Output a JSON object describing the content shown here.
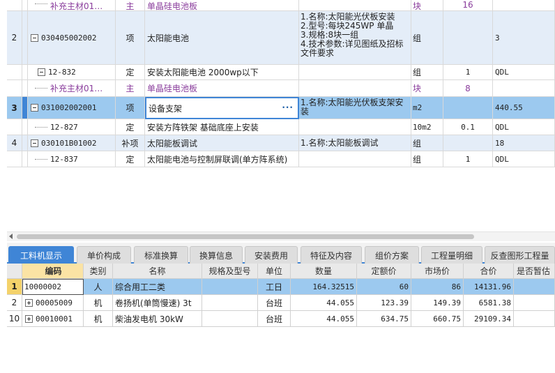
{
  "upper_grid": {
    "rows": [
      {
        "num": "",
        "code": "补充主材01…",
        "type": "主",
        "name": "单晶硅电池板",
        "feature": "",
        "unit": "块",
        "qty1": "16",
        "qty2": ""
      },
      {
        "num": "2",
        "code": "030405002002",
        "type": "项",
        "name": "太阳能电池",
        "feature": "1.名称:太阳能光伏板安装\n2.型号:每块245WP 单晶\n3.规格:8块一组\n4.技术参数:详见图纸及招标文件要求",
        "unit": "组",
        "qty1": "",
        "qty2": "3"
      },
      {
        "num": "",
        "code": "12-832",
        "type": "定",
        "name": "安装太阳能电池 2000wp以下",
        "feature": "",
        "unit": "组",
        "qty1": "1",
        "qty2": "QDL"
      },
      {
        "num": "",
        "code": "补充主材01…",
        "type": "主",
        "name": "单晶硅电池板",
        "feature": "",
        "unit": "块",
        "qty1": "8",
        "qty2": ""
      },
      {
        "num": "3",
        "code": "031002002001",
        "type": "项",
        "name": "设备支架",
        "feature": "1.名称:太阳能光伏板支架安装",
        "unit": "m2",
        "qty1": "",
        "qty2": "440.55",
        "ellipsis": "···"
      },
      {
        "num": "",
        "code": "12-827",
        "type": "定",
        "name": "安装方阵铁架 基础底座上安装",
        "feature": "",
        "unit": "10m2",
        "qty1": "0.1",
        "qty2": "QDL"
      },
      {
        "num": "4",
        "code": "030101B01002",
        "type": "补项",
        "name": "太阳能板调试",
        "feature": "1.名称:太阳能板调试",
        "unit": "组",
        "qty1": "",
        "qty2": "18"
      },
      {
        "num": "",
        "code": "12-837",
        "type": "定",
        "name": "太阳能电池与控制屏联调(单方阵系统)",
        "feature": "",
        "unit": "组",
        "qty1": "1",
        "qty2": "QDL"
      }
    ]
  },
  "tabs": [
    "工料机显示",
    "单价构成",
    "标准换算",
    "换算信息",
    "安装费用",
    "特征及内容",
    "组价方案",
    "工程量明细",
    "反查图形工程量"
  ],
  "lower_grid": {
    "headers": [
      "",
      "编码",
      "类别",
      "名称",
      "规格及型号",
      "单位",
      "数量",
      "定额价",
      "市场价",
      "合价",
      "是否暂估"
    ],
    "rows": [
      {
        "num": "1",
        "code": "10000002",
        "cat": "人",
        "name": "综合用工二类",
        "spec": "",
        "unit": "工日",
        "qty": "164.32515",
        "quota": "60",
        "market": "86",
        "total": "14131.96"
      },
      {
        "num": "2",
        "code": "00005009",
        "cat": "机",
        "name": "卷扬机(单筒慢速) 3t",
        "spec": "",
        "unit": "台班",
        "qty": "44.055",
        "quota": "123.39",
        "market": "149.39",
        "total": "6581.38"
      },
      {
        "num": "10",
        "code": "00010001",
        "cat": "机",
        "name": "柴油发电机 30kW",
        "spec": "",
        "unit": "台班",
        "qty": "44.055",
        "quota": "634.75",
        "market": "660.75",
        "total": "29109.34"
      }
    ]
  },
  "colors": {
    "accent": "#3f85d6",
    "selected_row": "#9cc9ef",
    "item_row": "#e4edf8",
    "material_text": "#8a3d9c"
  }
}
